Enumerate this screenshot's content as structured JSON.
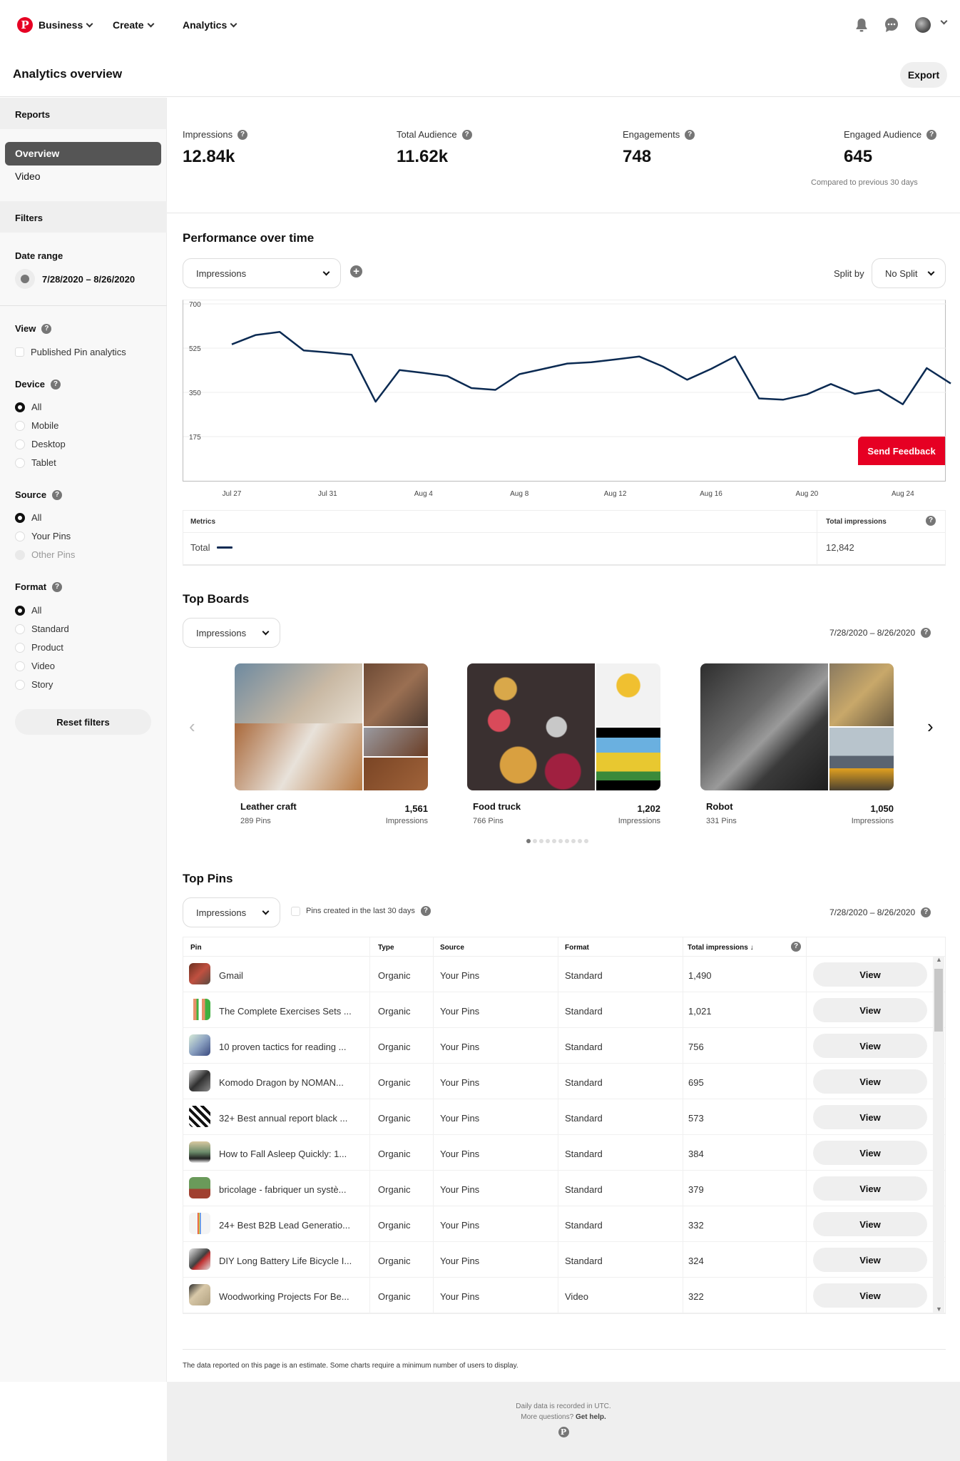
{
  "nav": {
    "logo": "P",
    "items": [
      {
        "label": "Business"
      },
      {
        "label": "Create"
      },
      {
        "label": "Analytics"
      }
    ],
    "icons": [
      "bell-icon",
      "messages-icon",
      "avatar",
      "account-chevron-icon"
    ]
  },
  "header": {
    "title": "Analytics overview",
    "export_label": "Export"
  },
  "sidebar": {
    "reports_title": "Reports",
    "reports": [
      {
        "label": "Overview",
        "active": true
      },
      {
        "label": "Video",
        "active": false
      }
    ],
    "filters_title": "Filters",
    "date_range_label": "Date range",
    "date_range_value": "7/28/2020 – 8/26/2020",
    "view": {
      "label": "View",
      "checkbox_label": "Published Pin analytics",
      "checked": false
    },
    "device": {
      "label": "Device",
      "options": [
        "All",
        "Mobile",
        "Desktop",
        "Tablet"
      ],
      "selected": "All"
    },
    "source": {
      "label": "Source",
      "options": [
        "All",
        "Your Pins",
        "Other Pins"
      ],
      "selected": "All",
      "disabled": [
        "Other Pins"
      ]
    },
    "format": {
      "label": "Format",
      "options": [
        "All",
        "Standard",
        "Product",
        "Video",
        "Story"
      ],
      "selected": "All"
    },
    "reset_label": "Reset filters"
  },
  "stats": [
    {
      "label": "Impressions",
      "value": "12.84k"
    },
    {
      "label": "Total Audience",
      "value": "11.62k"
    },
    {
      "label": "Engagements",
      "value": "748"
    },
    {
      "label": "Engaged Audience",
      "value": "645"
    }
  ],
  "stats_compare": "Compared to previous 30 days",
  "performance": {
    "title": "Performance over time",
    "metric_select": "Impressions",
    "split_label": "Split by",
    "split_select": "No Split",
    "feedback_label": "Send Feedback",
    "line_color": "#0b2a52"
  },
  "chart_data": {
    "type": "line",
    "title": "Performance over time",
    "xlabel": "",
    "ylabel": "Impressions",
    "ylim": [
      0,
      700
    ],
    "yticks": [
      175,
      350,
      525,
      700
    ],
    "grid": true,
    "x": [
      "Jul 27",
      "Jul 28",
      "Jul 29",
      "Jul 30",
      "Jul 31",
      "Aug 1",
      "Aug 2",
      "Aug 3",
      "Aug 4",
      "Aug 5",
      "Aug 6",
      "Aug 7",
      "Aug 8",
      "Aug 9",
      "Aug 10",
      "Aug 11",
      "Aug 12",
      "Aug 13",
      "Aug 14",
      "Aug 15",
      "Aug 16",
      "Aug 17",
      "Aug 18",
      "Aug 19",
      "Aug 20",
      "Aug 21",
      "Aug 22",
      "Aug 23",
      "Aug 24",
      "Aug 25"
    ],
    "xtick_labels": [
      "Jul 27",
      "Jul 31",
      "Aug 4",
      "Aug 8",
      "Aug 12",
      "Aug 16",
      "Aug 20",
      "Aug 24"
    ],
    "series": [
      {
        "name": "Total",
        "values": [
          540,
          577,
          589,
          516,
          508,
          499,
          313,
          438,
          427,
          414,
          367,
          360,
          422,
          443,
          464,
          469,
          480,
          492,
          452,
          400,
          443,
          492,
          326,
          321,
          342,
          383,
          344,
          360,
          303,
          446,
          385
        ]
      }
    ]
  },
  "metrics_table": {
    "col_metric": "Metrics",
    "col_total": "Total impressions",
    "rows": [
      {
        "name": "Total",
        "value": "12,842"
      }
    ]
  },
  "top_boards": {
    "title": "Top Boards",
    "select": "Impressions",
    "date_range": "7/28/2020 – 8/26/2020",
    "boards": [
      {
        "name": "Leather craft",
        "pins": "289 Pins",
        "value": "1,561",
        "metric": "Impressions"
      },
      {
        "name": "Food truck",
        "pins": "766 Pins",
        "value": "1,202",
        "metric": "Impressions"
      },
      {
        "name": "Robot",
        "pins": "331 Pins",
        "value": "1,050",
        "metric": "Impressions"
      }
    ],
    "page_count": 10,
    "current_page": 1,
    "prev": "‹",
    "next": "›"
  },
  "top_pins": {
    "title": "Top Pins",
    "select": "Impressions",
    "checkbox_label": "Pins created in the last 30 days",
    "date_range": "7/28/2020 – 8/26/2020",
    "columns": [
      "Pin",
      "Type",
      "Source",
      "Format",
      "Total impressions ↓"
    ],
    "view_label": "View",
    "rows": [
      {
        "pin": "Gmail",
        "type": "Organic",
        "source": "Your Pins",
        "format": "Standard",
        "impressions": "1,490"
      },
      {
        "pin": "The Complete Exercises Sets ...",
        "type": "Organic",
        "source": "Your Pins",
        "format": "Standard",
        "impressions": "1,021"
      },
      {
        "pin": "10 proven tactics for reading ...",
        "type": "Organic",
        "source": "Your Pins",
        "format": "Standard",
        "impressions": "756"
      },
      {
        "pin": "Komodo Dragon by NOMAN...",
        "type": "Organic",
        "source": "Your Pins",
        "format": "Standard",
        "impressions": "695"
      },
      {
        "pin": "32+ Best annual report black ...",
        "type": "Organic",
        "source": "Your Pins",
        "format": "Standard",
        "impressions": "573"
      },
      {
        "pin": "How to Fall Asleep Quickly: 1...",
        "type": "Organic",
        "source": "Your Pins",
        "format": "Standard",
        "impressions": "384"
      },
      {
        "pin": "bricolage - fabriquer un systè...",
        "type": "Organic",
        "source": "Your Pins",
        "format": "Standard",
        "impressions": "379"
      },
      {
        "pin": "24+ Best B2B Lead Generatio...",
        "type": "Organic",
        "source": "Your Pins",
        "format": "Standard",
        "impressions": "332"
      },
      {
        "pin": "DIY Long Battery Life Bicycle I...",
        "type": "Organic",
        "source": "Your Pins",
        "format": "Standard",
        "impressions": "324"
      },
      {
        "pin": "Woodworking Projects For Be...",
        "type": "Organic",
        "source": "Your Pins",
        "format": "Video",
        "impressions": "322"
      }
    ]
  },
  "footer": {
    "note": "The data reported on this page is an estimate. Some charts require a minimum number of users to display.",
    "utc": "Daily data is recorded in UTC.",
    "questions": "More questions?",
    "help_link": "Get help."
  }
}
